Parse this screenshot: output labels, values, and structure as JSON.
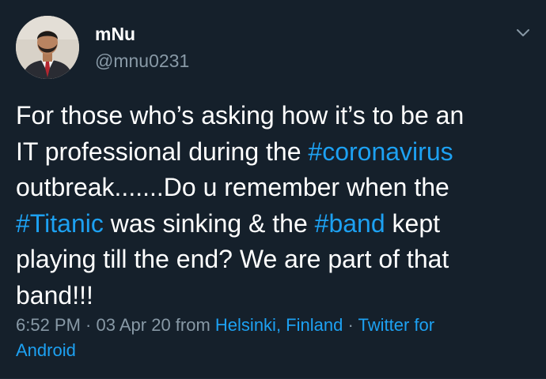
{
  "user": {
    "display_name": "mNu",
    "handle": "@mnu0231"
  },
  "tweet": {
    "line1": "For those who’s asking how it’s to be an",
    "line2_a": "IT professional during the ",
    "line2_tag": "#coronavirus",
    "line3": "outbreak.......Do u remember when the",
    "line4_tag1": "#Titanic",
    "line4_b": " was sinking & the ",
    "line4_tag2": "#band",
    "line4_c": " kept",
    "line5": "playing till the end? We are part of that",
    "line6": "band!!!"
  },
  "meta": {
    "time": "6:52 PM",
    "sep1": " · ",
    "date": "03 Apr 20",
    "from": " from ",
    "location": "Helsinki, Finland",
    "sep2": " · ",
    "source_a": "Twitter for",
    "source_b": "Android"
  },
  "icons": {
    "caret": "chevron-down-icon",
    "avatar": "avatar-photo"
  },
  "colors": {
    "background": "#15202b",
    "primary_text": "#ffffff",
    "secondary_text": "#8899a6",
    "link": "#1da1f2"
  }
}
